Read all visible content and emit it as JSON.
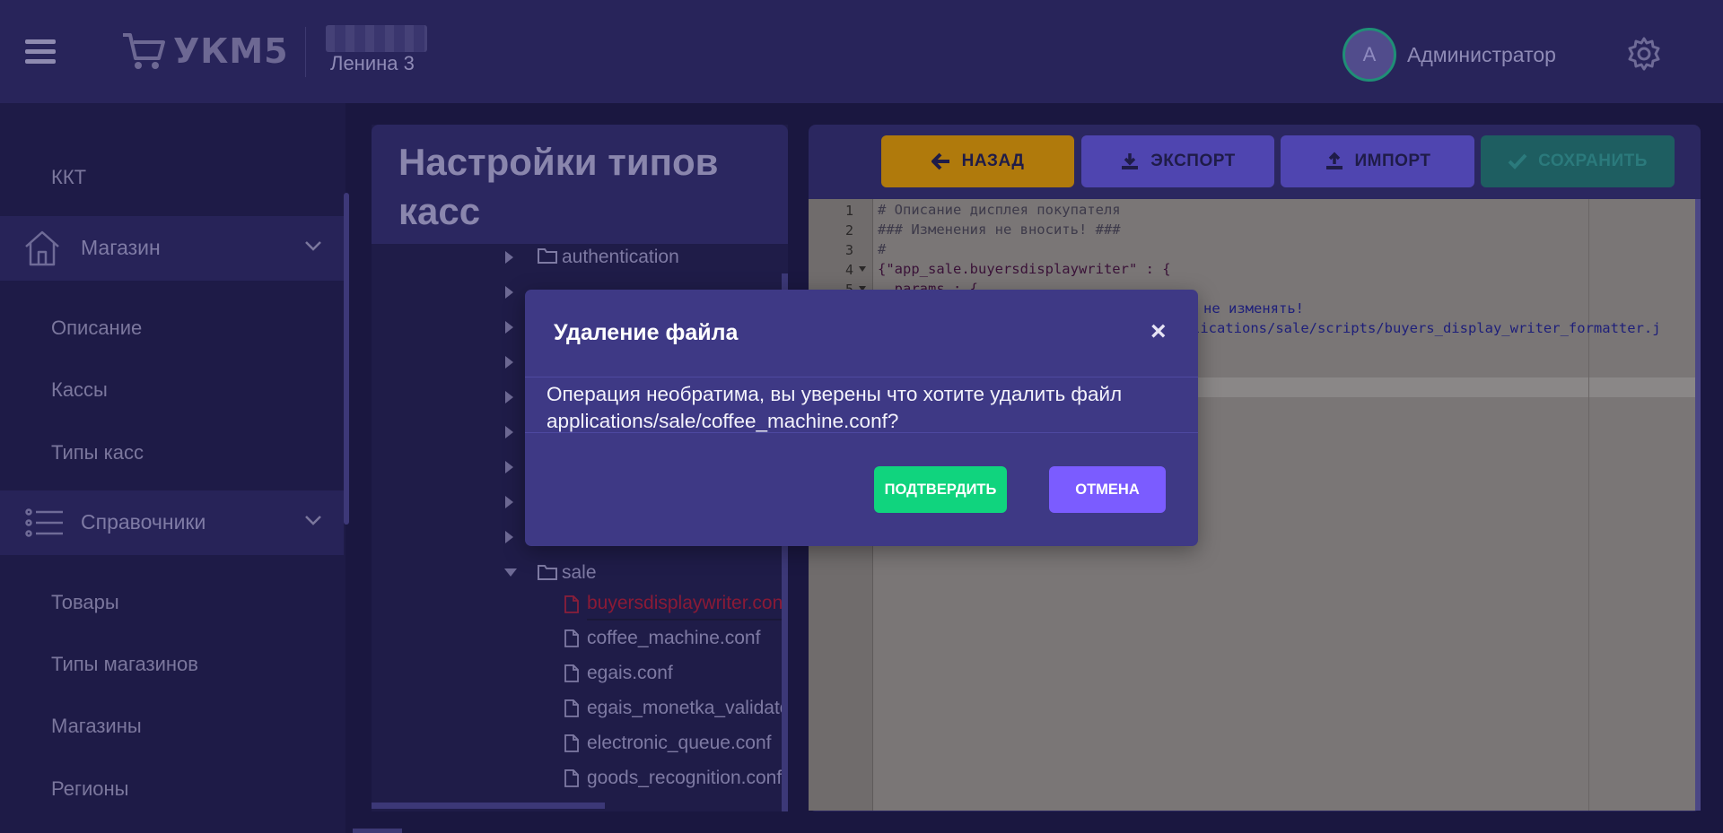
{
  "header": {
    "logo_text": "УКМ5",
    "store_name": "Ленина 3",
    "avatar_letter": "A",
    "user_name": "Администратор"
  },
  "sidebar": {
    "kkt": "ККТ",
    "group_store": "Магазин",
    "store_items": [
      "Описание",
      "Кассы",
      "Типы касс"
    ],
    "group_refs": "Справочники",
    "refs_items": [
      "Товары",
      "Типы магазинов",
      "Магазины",
      "Регионы"
    ]
  },
  "panel": {
    "title": "Настройки типов касс"
  },
  "tree": {
    "authentication": "authentication",
    "sale": "sale",
    "files": [
      "buyersdisplaywriter.conf",
      "coffee_machine.conf",
      "egais.conf",
      "egais_monetka_validator.conf",
      "electronic_queue.conf",
      "goods_recognition.conf"
    ]
  },
  "toolbar": {
    "back": "НАЗАД",
    "export": "ЭКСПОРТ",
    "import": "ИМПОРТ",
    "save": "СОХРАНИТЬ"
  },
  "editor": {
    "line_numbers": [
      "1",
      "2",
      "3",
      "4",
      "5"
    ],
    "lines": [
      "# Описание дисплея покупателя",
      "### Изменения не вносить! ###",
      "#",
      "{\"app_sale.buyersdisplaywriter\" : {",
      "  params : {"
    ],
    "fragment_1": "тр не изменять!",
    "fragment_2": "lications/sale/scripts/buyers_display_writer_formatter.j"
  },
  "modal": {
    "title": "Удаление файла",
    "close": "×",
    "body": "Операция необратима, вы уверены что хотите удалить файл applications/sale/coffee_machine.conf?",
    "confirm": "ПОДТВЕРДИТЬ",
    "cancel": "ОТМЕНА"
  },
  "colors": {
    "back_button": "#b07a0c",
    "export_button": "#4f45b0",
    "import_button": "#4f45b0",
    "save_button": "#1e5e61",
    "confirm_button": "#10d47e",
    "cancel_button": "#7b5cff",
    "modal_bg": "#3e3985"
  }
}
